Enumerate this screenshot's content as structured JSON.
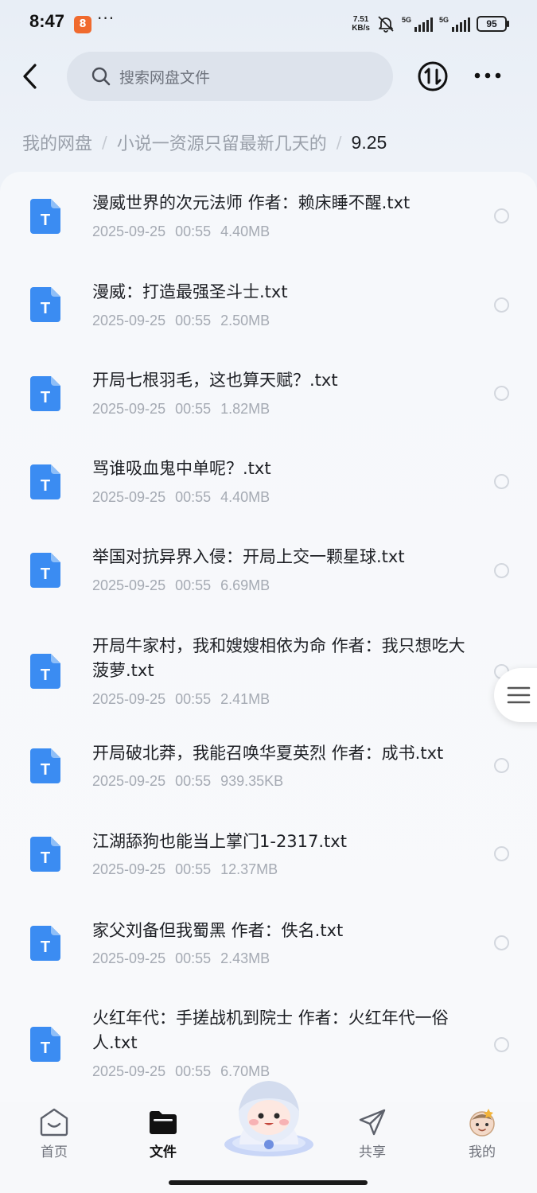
{
  "status_bar": {
    "time": "8:47",
    "app_icon_glyph": "8",
    "dots": "···",
    "net_speed_value": "7.51",
    "net_speed_unit": "KB/s",
    "sim1_label": "5G",
    "sim2_label": "5G",
    "battery": "95"
  },
  "header": {
    "search_placeholder": "搜索网盘文件",
    "icons": {
      "back": "chevron-left-icon",
      "search": "search-icon",
      "transfer": "transfer-icon",
      "more": "more-icon"
    }
  },
  "breadcrumb": {
    "items": [
      "我的网盘",
      "小说一资源只留最新几天的"
    ],
    "separator": "/",
    "current": "9.25"
  },
  "files": [
    {
      "name": "漫威世界的次元法师 作者：赖床睡不醒.txt",
      "date": "2025-09-25",
      "time": "00:55",
      "size": "4.40MB"
    },
    {
      "name": "漫威：打造最强圣斗士.txt",
      "date": "2025-09-25",
      "time": "00:55",
      "size": "2.50MB"
    },
    {
      "name": "开局七根羽毛，这也算天赋？.txt",
      "date": "2025-09-25",
      "time": "00:55",
      "size": "1.82MB"
    },
    {
      "name": "骂谁吸血鬼中单呢？.txt",
      "date": "2025-09-25",
      "time": "00:55",
      "size": "4.40MB"
    },
    {
      "name": "举国对抗异界入侵：开局上交一颗星球.txt",
      "date": "2025-09-25",
      "time": "00:55",
      "size": "6.69MB"
    },
    {
      "name": "开局牛家村，我和嫂嫂相依为命 作者：我只想吃大菠萝.txt",
      "date": "2025-09-25",
      "time": "00:55",
      "size": "2.41MB"
    },
    {
      "name": "开局破北莽，我能召唤华夏英烈 作者：成书.txt",
      "date": "2025-09-25",
      "time": "00:55",
      "size": "939.35KB"
    },
    {
      "name": "江湖舔狗也能当上掌门1-2317.txt",
      "date": "2025-09-25",
      "time": "00:55",
      "size": "12.37MB"
    },
    {
      "name": "家父刘备但我蜀黑 作者：佚名.txt",
      "date": "2025-09-25",
      "time": "00:55",
      "size": "2.43MB"
    },
    {
      "name": "火红年代：手搓战机到院士 作者：火红年代一俗人.txt",
      "date": "2025-09-25",
      "time": "00:55",
      "size": "6.70MB"
    }
  ],
  "file_icon_letter": "T",
  "bottom_nav": {
    "items": [
      {
        "label": "首页",
        "icon": "home-icon",
        "active": false
      },
      {
        "label": "文件",
        "icon": "folder-icon",
        "active": true
      },
      {
        "label": "共享",
        "icon": "share-icon",
        "active": false
      },
      {
        "label": "我的",
        "icon": "profile-avatar-icon",
        "active": false
      }
    ]
  },
  "colors": {
    "accent_blue": "#3b8cf2",
    "background": "#eef2f8",
    "search_bg": "#dde3ec",
    "text_primary": "#1d1f24",
    "text_secondary": "#a5aab3"
  }
}
